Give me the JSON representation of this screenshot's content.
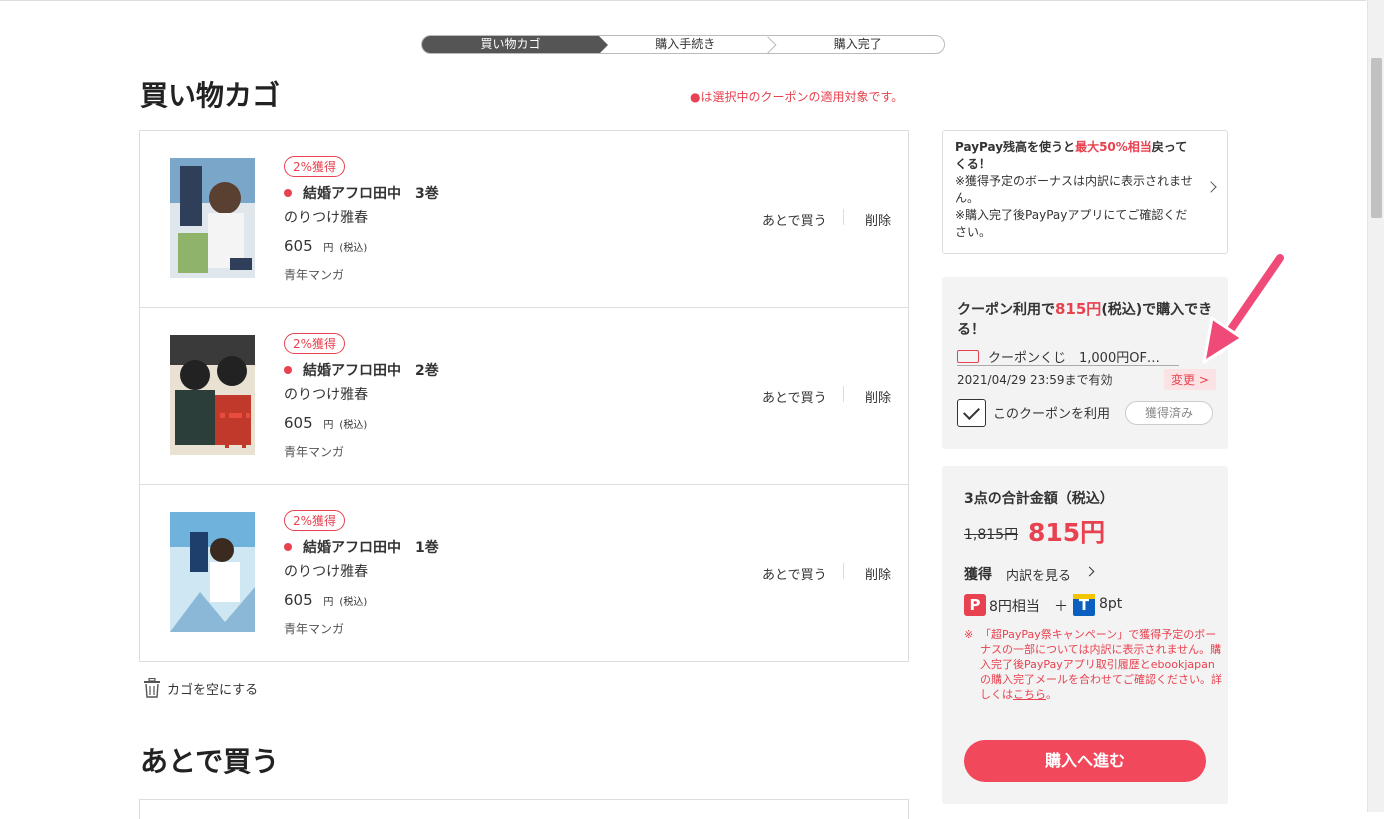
{
  "steps": {
    "cart": "買い物カゴ",
    "checkout": "購入手続き",
    "complete": "購入完了"
  },
  "cart": {
    "title": "買い物カゴ",
    "coupon_note": "●は選択中のクーポンの適用対象です。",
    "items": [
      {
        "badge": "2%獲得",
        "title": "結婚アフロ田中　3巻",
        "author": "のりつけ雅春",
        "price": "605",
        "price_unit": "円",
        "tax": "(税込)",
        "genre": "青年マンガ",
        "later": "あとで買う",
        "delete": "削除"
      },
      {
        "badge": "2%獲得",
        "title": "結婚アフロ田中　2巻",
        "author": "のりつけ雅春",
        "price": "605",
        "price_unit": "円",
        "tax": "(税込)",
        "genre": "青年マンガ",
        "later": "あとで買う",
        "delete": "削除"
      },
      {
        "badge": "2%獲得",
        "title": "結婚アフロ田中　1巻",
        "author": "のりつけ雅春",
        "price": "605",
        "price_unit": "円",
        "tax": "(税込)",
        "genre": "青年マンガ",
        "later": "あとで買う",
        "delete": "削除"
      }
    ],
    "empty_label": "カゴを空にする"
  },
  "later": {
    "title": "あとで買う"
  },
  "paypay": {
    "line1_a": "PayPay残高を使うと",
    "line1_red": "最大50%相当",
    "line1_b": "戻ってくる！",
    "note1": "※獲得予定のボーナスは内訳に表示されません。",
    "note2": "※購入完了後PayPayアプリにてご確認ください。"
  },
  "coupon": {
    "head_a": "クーポン利用で",
    "head_price": "815円",
    "head_b": "(税込)で購入できる！",
    "name": "クーポンくじ　1,000円OF…",
    "expire": "2021/04/29 23:59まで有効",
    "change": "変更 >",
    "use_label": "このクーポンを利用",
    "acquired": "獲得済み"
  },
  "total": {
    "label": "3点の合計金額（税込）",
    "old_price": "1,815円",
    "new_price": "815円",
    "earn_label": "獲得",
    "earn_detail": "内訳を見る",
    "paypay_icon": "P",
    "paypay_amount": "8円相当",
    "plus": "＋",
    "t_icon": "T",
    "t_amount": "8pt",
    "notice_mark": "※",
    "notice": "「超PayPay祭キャンペーン」で獲得予定のボーナスの一部については内訳に表示されません。購入完了後PayPayアプリ取引履歴とebookjapanの購入完了メールを合わせてご確認ください。詳しくは",
    "notice_link": "こちら",
    "notice_end": "。",
    "buy_button": "購入へ進む"
  },
  "colors": {
    "accent": "#e8414f",
    "buy_button": "#f2485c",
    "active_step": "#555555",
    "panel_bg": "#f3f3f3"
  }
}
